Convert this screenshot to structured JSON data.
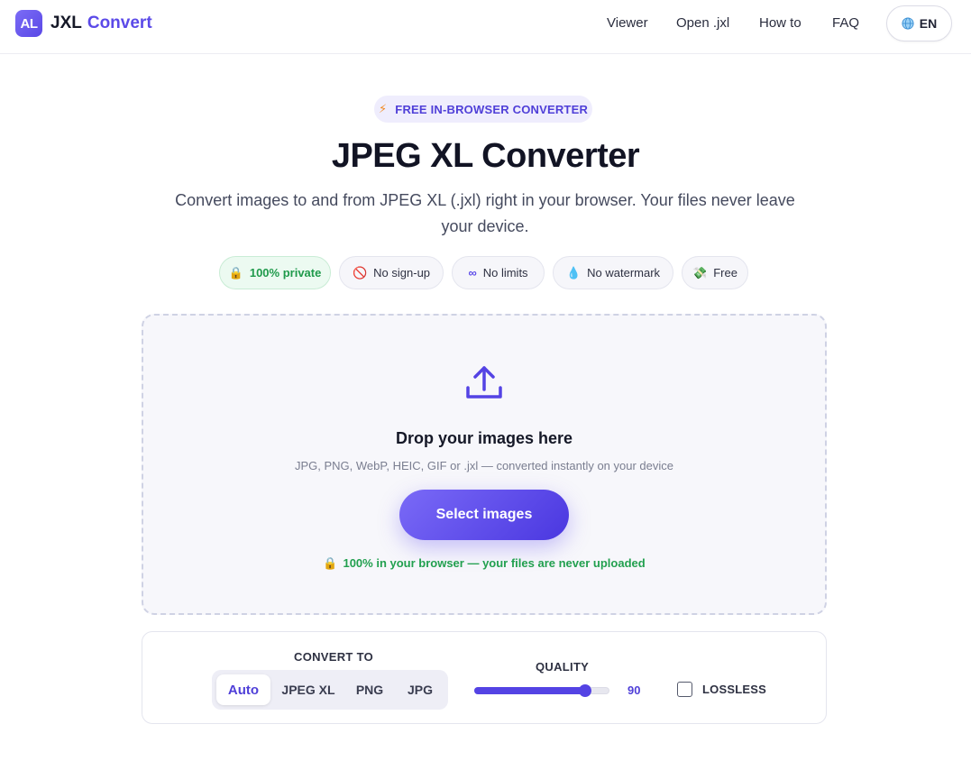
{
  "header": {
    "logo_mark": "AL",
    "logo_text_1": "JXL",
    "logo_text_2": "Convert",
    "nav": [
      "Viewer",
      "Open .jxl",
      "How to",
      "FAQ"
    ],
    "lang": "EN"
  },
  "hero": {
    "badge": "FREE IN-BROWSER CONVERTER",
    "title": "JPEG XL Converter",
    "subtitle": "Convert images to and from JPEG XL (.jxl) right in your browser. Your files never leave your device.",
    "chips": [
      {
        "icon": "🔒",
        "label": "100% private",
        "icon_name": "lock-icon"
      },
      {
        "icon": "🚫",
        "label": "No sign-up",
        "icon_name": "no-entry-icon"
      },
      {
        "icon": "∞",
        "label": "No limits",
        "icon_name": "infinity-icon"
      },
      {
        "icon": "💧",
        "label": "No watermark",
        "icon_name": "droplet-icon"
      },
      {
        "icon": "💸",
        "label": "Free",
        "icon_name": "money-icon"
      }
    ]
  },
  "dropzone": {
    "title": "Drop your images here",
    "subtitle": "JPG, PNG, WebP, HEIC, GIF or .jxl — converted instantly on your device",
    "button": "Select images",
    "note_icon": "🔒",
    "note": "100% in your browser — your files are never uploaded"
  },
  "settings": {
    "convert_to_label": "CONVERT TO",
    "formats": [
      "Auto",
      "JPEG XL",
      "PNG",
      "JPG"
    ],
    "selected_format": "Auto",
    "quality_label": "QUALITY",
    "quality_value": "90",
    "quality_fraction": 0.9,
    "lossless_label": "LOSSLESS",
    "lossless_checked": false
  },
  "colors": {
    "accent": "#5b4ae8",
    "success": "#22a04f",
    "badge_bolt": "#f08a24"
  }
}
